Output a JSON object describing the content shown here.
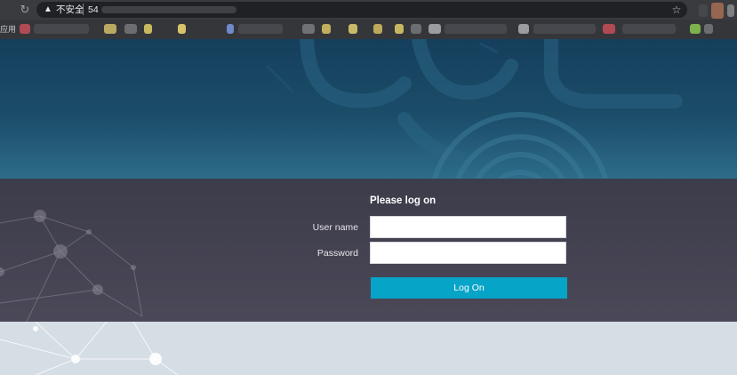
{
  "browser": {
    "security_label": "不安全",
    "url_text": "54",
    "reload_icon": "reload-icon",
    "warning_icon": "warning-triangle-icon",
    "star_icon": "bookmark-star-icon"
  },
  "bookmarks_bar": {
    "label": "应用"
  },
  "login": {
    "title": "Please log on",
    "username_label": "User name",
    "password_label": "Password",
    "username_value": "",
    "password_value": "",
    "logon_label": "Log On"
  },
  "colors": {
    "accent": "#06a4c7",
    "hero_top": "#153f5c",
    "login_band": "#3c3c4a",
    "bottom": "#d5dde5"
  }
}
